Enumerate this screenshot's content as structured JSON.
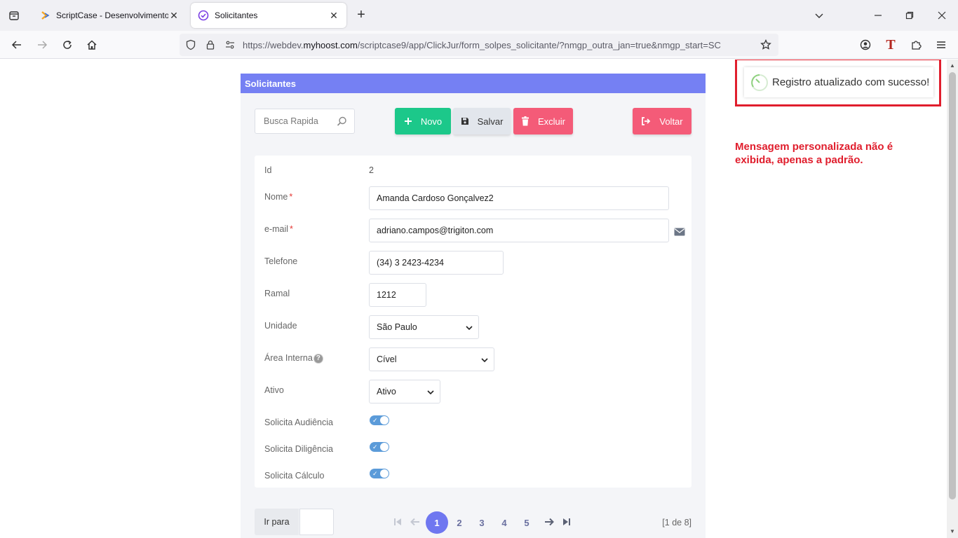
{
  "browser": {
    "tabs": [
      {
        "title": "ScriptCase - Desenvolvimento -"
      },
      {
        "title": "Solicitantes"
      }
    ],
    "url": {
      "prefix": "https://webdev.",
      "domain": "myhoost.com",
      "path": "/scriptcase9/app/ClickJur/form_solpes_solicitante/?nmgp_outra_jan=true&nmgp_start=SC"
    },
    "profile_letter": "T"
  },
  "form": {
    "header_title": "Solicitantes",
    "search_placeholder": "Busca Rapida",
    "buttons": {
      "novo": "Novo",
      "salvar": "Salvar",
      "excluir": "Excluir",
      "voltar": "Voltar"
    },
    "fields": {
      "id": {
        "label": "Id",
        "value": "2"
      },
      "nome": {
        "label": "Nome",
        "required": "*",
        "value": "Amanda Cardoso Gonçalvez2"
      },
      "email": {
        "label": "e-mail",
        "required": "*",
        "value": "adriano.campos@trigiton.com"
      },
      "telefone": {
        "label": "Telefone",
        "value": "(34) 3 2423-4234"
      },
      "ramal": {
        "label": "Ramal",
        "value": "1212"
      },
      "unidade": {
        "label": "Unidade",
        "value": "São Paulo"
      },
      "area_interna": {
        "label": "Área Interna",
        "help": "?",
        "value": "Cível"
      },
      "ativo": {
        "label": "Ativo",
        "value": "Ativo"
      },
      "solicita_audiencia": {
        "label": "Solicita Audiência",
        "checked": true
      },
      "solicita_diligencia": {
        "label": "Solicita Diligência",
        "checked": true
      },
      "solicita_calculo": {
        "label": "Solicita Cálculo",
        "checked": true
      }
    },
    "pager": {
      "goto_label": "Ir para",
      "pages": [
        "1",
        "2",
        "3",
        "4",
        "5"
      ],
      "current_page": "1",
      "info": "[1 de 8]"
    }
  },
  "toast": {
    "message": "Registro atualizado com sucesso!"
  },
  "annotation": {
    "text": "Mensagem personalizada não é exibida, apenas a padrão."
  },
  "colors": {
    "header": "#7580f3",
    "success": "#1cc88a",
    "danger": "#f45b78",
    "highlight": "#e01e2d"
  }
}
